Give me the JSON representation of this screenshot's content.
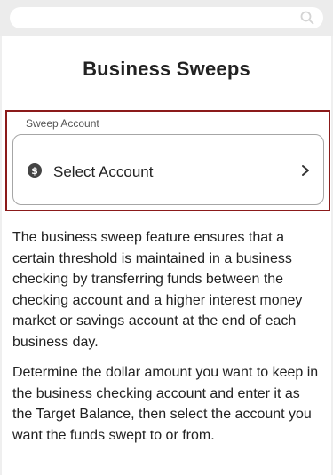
{
  "search": {
    "icon": "search-icon"
  },
  "page": {
    "title": "Business Sweeps"
  },
  "sweep_account": {
    "label": "Sweep Account",
    "value": "Select Account",
    "leading_icon": "dollar-circle-icon",
    "trailing_icon": "chevron-right-icon",
    "focus_color": "#8b1a1a"
  },
  "description": {
    "paragraph_1": "The business sweep feature ensures that a certain threshold is maintained in a business checking by transferring funds between the checking account and a higher interest money market or savings account at the end of each business day.",
    "paragraph_2": "Determine the dollar amount you want to keep in the business checking account and enter it as the Target Balance, then select the account you want the funds swept to or from."
  }
}
